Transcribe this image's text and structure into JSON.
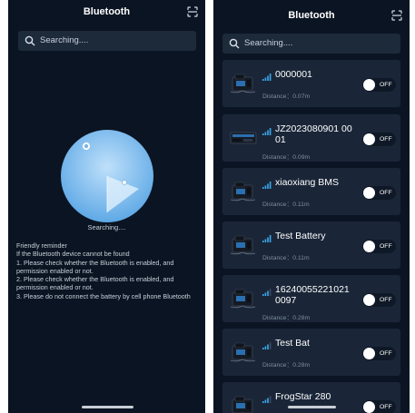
{
  "left_screen": {
    "title": "Bluetooth",
    "search": {
      "placeholder": "Searching...."
    },
    "status_text": "Searching....",
    "reminder": {
      "heading": "Friendly reminder",
      "lines": [
        "If the Bluetooth device cannot be found",
        "1. Please check whether the Bluetooth is enabled, and permission enabled or not.",
        "2. Please check whether the Bluetooth is enabled, and permission enabled or not.",
        "3. Please do not connect the battery by cell phone Bluetooth"
      ]
    }
  },
  "right_screen": {
    "title": "Bluetooth",
    "search": {
      "placeholder": "Searching...."
    },
    "devices": [
      {
        "name": "0000001",
        "distance": "Distance：0.07m",
        "toggle": "OFF",
        "signal": 4
      },
      {
        "name": "JZ2023080901 00 01",
        "distance": "Distance：0.09m",
        "toggle": "OFF",
        "signal": 4
      },
      {
        "name": "xiaoxiang BMS",
        "distance": "Distance：0.11m",
        "toggle": "OFF",
        "signal": 4
      },
      {
        "name": "Test Battery",
        "distance": "Distance：0.11m",
        "toggle": "OFF",
        "signal": 4
      },
      {
        "name": "16240055221021 0097",
        "distance": "Distance：0.28m",
        "toggle": "OFF",
        "signal": 3
      },
      {
        "name": "Test Bat",
        "distance": "Distance：0.28m",
        "toggle": "OFF",
        "signal": 3
      },
      {
        "name": "FrogStar 280",
        "distance": "",
        "toggle": "OFF",
        "signal": 3
      }
    ]
  },
  "icons": {
    "scan": "scan-icon",
    "search": "search-icon",
    "radar": "radar-icon",
    "signal": "signal-strength-icon",
    "battery_device": "battery-device-icon"
  },
  "colors": {
    "background": "#0b1422",
    "card": "#1a2638",
    "search_bar": "#1d2a3a",
    "accent_signal": "#3aa8ee",
    "radar": "#7ec0f2"
  }
}
